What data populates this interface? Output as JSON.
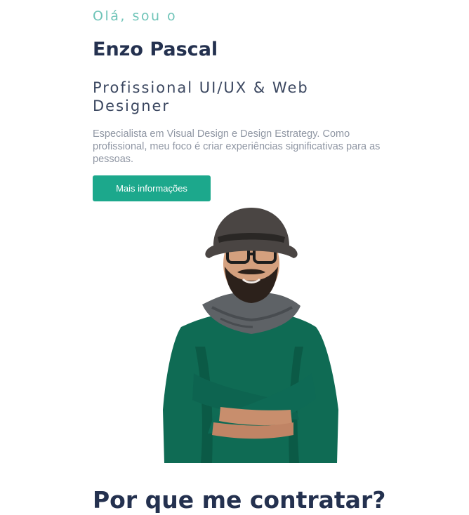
{
  "hero": {
    "greeting": "Olá, sou o",
    "name": "Enzo Pascal",
    "role": "Profissional UI/UX & Web Designer",
    "description": "Especialista em Visual Design e Design Estrategy. Como profissional, meu foco é criar experiências significativas para as pessoas.",
    "cta_label": "Mais informações"
  },
  "section": {
    "title": "Por que me contratar?"
  },
  "colors": {
    "accent": "#1ca88c",
    "greeting": "#6fc4b8",
    "heading": "#24314f",
    "body_text": "#8f96a3"
  }
}
